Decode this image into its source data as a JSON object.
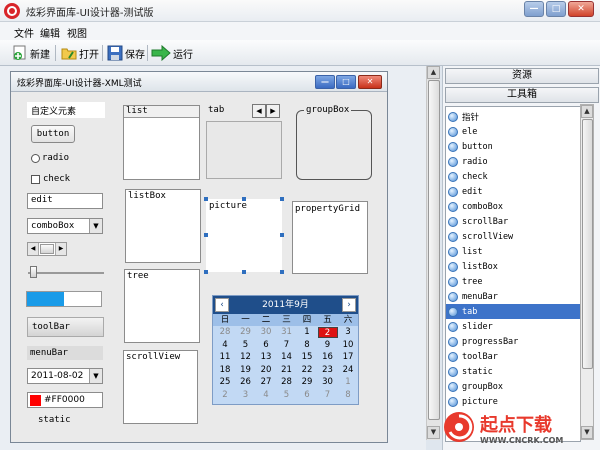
{
  "window": {
    "title": "炫彩界面库-UI设计器-测试版"
  },
  "menu": [
    "文件",
    "编辑",
    "视图"
  ],
  "toolbar": {
    "new_label": "新建",
    "open_label": "打开",
    "save_label": "保存",
    "run_label": "运行"
  },
  "child_window": {
    "title": "炫彩界面库-UI设计器-XML测试"
  },
  "widgets": {
    "custom_element": "自定义元素",
    "button": "button",
    "radio": "radio",
    "check": "check",
    "edit": "edit",
    "combobox": "comboBox",
    "toolbar": "toolBar",
    "menubar": "menuBar",
    "date_value": "2011-08-02",
    "color_value": "#FF0000",
    "static": "static",
    "list": "list",
    "listbox": "listBox",
    "tree": "tree",
    "scrollview": "scrollView",
    "tab": "tab",
    "picture": "picture",
    "groupbox": "groupBox",
    "propertygrid": "propertyGrid",
    "progress_value": 0.5,
    "accent_color": "#1a9be8",
    "color_swatch": "#ff0000"
  },
  "calendar": {
    "month_label": "2011年9月",
    "weekdays": [
      "日",
      "一",
      "二",
      "三",
      "四",
      "五",
      "六"
    ],
    "selected_day": "2",
    "weeks": [
      [
        "28",
        "29",
        "30",
        "31",
        "1",
        "2",
        "3"
      ],
      [
        "4",
        "5",
        "6",
        "7",
        "8",
        "9",
        "10"
      ],
      [
        "11",
        "12",
        "13",
        "14",
        "15",
        "16",
        "17"
      ],
      [
        "18",
        "19",
        "20",
        "21",
        "22",
        "23",
        "24"
      ],
      [
        "25",
        "26",
        "27",
        "28",
        "29",
        "30",
        "1"
      ],
      [
        "2",
        "3",
        "4",
        "5",
        "6",
        "7",
        "8"
      ]
    ],
    "header_color": "#1f4e8a",
    "body_color": "#c2d9f4"
  },
  "right_panel": {
    "resources_tab": "资源",
    "toolbox_tab": "工具箱",
    "selected_item": "tab",
    "items": [
      "指针",
      "ele",
      "button",
      "radio",
      "check",
      "edit",
      "comboBox",
      "scrollBar",
      "scrollView",
      "list",
      "listBox",
      "tree",
      "menuBar",
      "tab",
      "slider",
      "progressBar",
      "toolBar",
      "static",
      "groupBox",
      "picture"
    ]
  },
  "watermark": {
    "brand": "起点下载",
    "url": "WWW.CNCRK.COM"
  }
}
